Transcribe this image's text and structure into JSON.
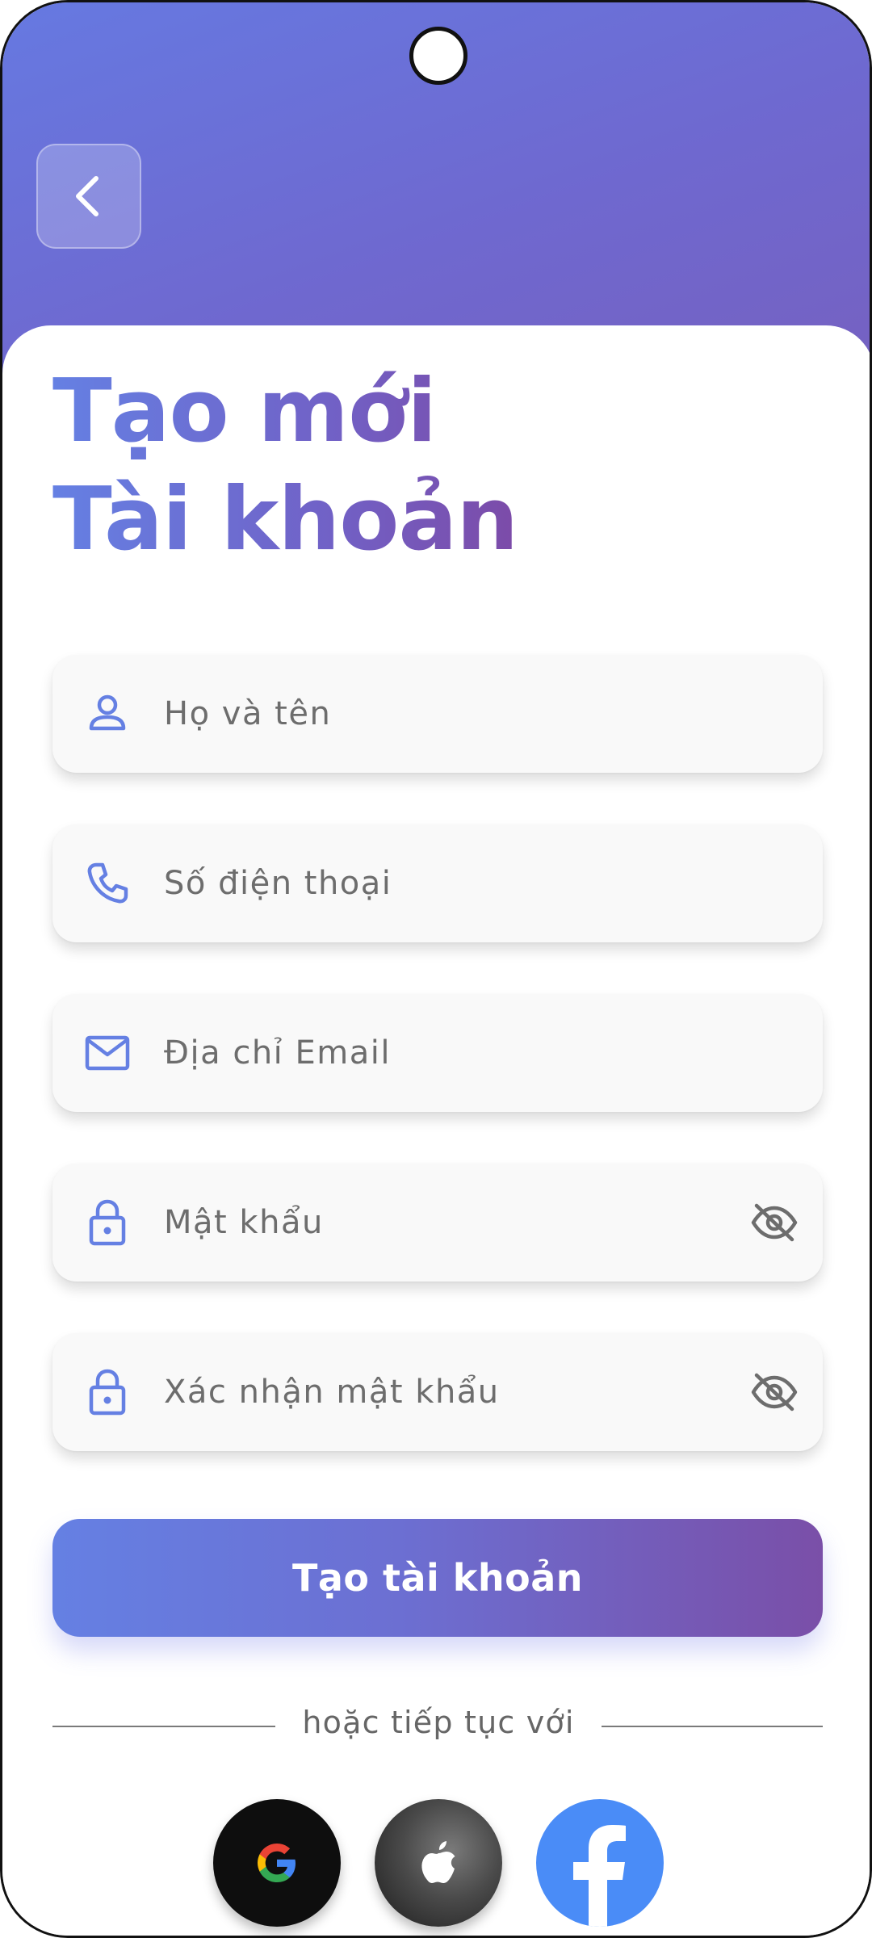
{
  "header": {
    "back_icon": "chevron-left-icon"
  },
  "title": {
    "line1": "Tạo mới",
    "line2": "Tài khoản"
  },
  "form": {
    "fullname": {
      "placeholder": "Họ và tên",
      "value": "",
      "icon": "person-icon"
    },
    "phone": {
      "placeholder": "Số điện thoại",
      "value": "",
      "icon": "phone-icon"
    },
    "email": {
      "placeholder": "Địa chỉ Email",
      "value": "",
      "icon": "mail-icon"
    },
    "password": {
      "placeholder": "Mật khẩu",
      "value": "",
      "icon": "lock-icon",
      "toggle_icon": "eye-off-icon"
    },
    "confirm_password": {
      "placeholder": "Xác nhận mật khẩu",
      "value": "",
      "icon": "lock-icon",
      "toggle_icon": "eye-off-icon"
    }
  },
  "submit_label": "Tạo tài khoản",
  "divider_text": "hoặc tiếp tục với",
  "social": [
    {
      "name": "google",
      "icon": "google-icon"
    },
    {
      "name": "apple",
      "icon": "apple-icon"
    },
    {
      "name": "facebook",
      "icon": "facebook-icon"
    }
  ],
  "colors": {
    "gradient_start": "#6580e3",
    "gradient_end": "#7a4fa8",
    "icon_color": "#6580e3",
    "facebook_blue": "#4a8cf7"
  }
}
